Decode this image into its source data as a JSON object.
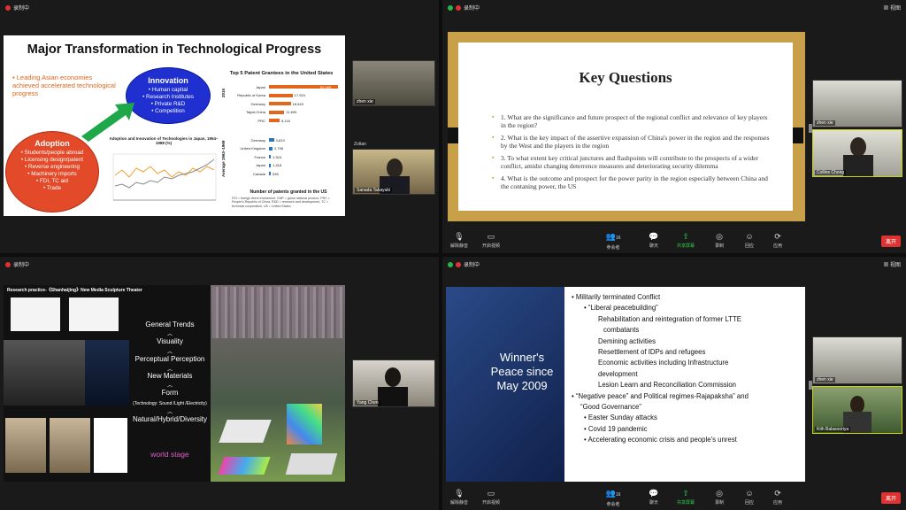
{
  "recording_label": "录制中",
  "view_label": "视图",
  "quad1": {
    "slide_title": "Major Transformation in Technological Progress",
    "lead_text": "Leading Asian economies achieved accelerated technological progress",
    "innovation": {
      "title": "Innovation",
      "items": [
        "Human capital",
        "Research Institutes",
        "Private R&D",
        "Competition"
      ]
    },
    "adoption": {
      "title": "Adoption",
      "items": [
        "Students/people abroad",
        "Licensing design/patent",
        "Reverse engineering",
        "Machinery imports",
        "FDI, TC aid",
        "Trade"
      ]
    },
    "chart_title": "Top 5 Patent Grantees in the United States",
    "chart_year_top": "2015",
    "chart_year_bottom": "Average 1963–1969",
    "chart_footer": "Number of patents granted in the US",
    "small_chart_title": "Adoption and Innovation of Technologies in Japan, 1954–1988 (%)",
    "footnote": "FDI = foreign direct investment, GNP = gross national product, PRC = People's Republic of China, R&D = research and development, TC = technical cooperation, US = United States",
    "participant1": "zhen xie",
    "participant2": "Zoltan",
    "participant2b": "Sanada Takayuki"
  },
  "chart_data": [
    {
      "type": "bar",
      "title": "Top 5 Patent Grantees in the United States",
      "xlabel": "Number of patents granted in the US",
      "groups": [
        {
          "name": "2015",
          "categories": [
            "Japan",
            "Republic of Korea",
            "Germany",
            "Taipei,China",
            "PRC"
          ],
          "values": [
            52409,
            17924,
            16549,
            11690,
            8116
          ]
        },
        {
          "name": "Average 1963–1969",
          "categories": [
            "Germany",
            "United Kingdom",
            "France",
            "Japan",
            "Canada"
          ],
          "values": [
            3819,
            2708,
            1324,
            1418,
            535
          ]
        }
      ]
    }
  ],
  "quad2": {
    "slide_title": "Key Questions",
    "questions": [
      "1. What are the significance and future prospect of the regional conflict and relevance of key players in the region?",
      "2. What is the key impact of the assertive expansion of China's power in the region and the responses by the West and the players in the region",
      "3. To what extent key critical junctures and flashpoints will contribute to the prospects of a wider conflict, amidst changing deterrence measures and deteriorating security dilemma",
      "4. What is the outcome and prospect for the power parity in the region especially between China and the contaning  power, the US"
    ],
    "participant1": "zhen xie",
    "participant2": "Collins Chong",
    "toolbar": [
      "解除静音",
      "开启视频",
      "参会者",
      "聊天",
      "共享屏幕",
      "录制",
      "回应",
      "应用"
    ],
    "participant_count": "16",
    "end_label": "离开"
  },
  "quad3": {
    "header": "Research practice-《Shanhaijing》New Media Sculpture Theater",
    "trends": [
      "General Trends",
      "Visuality",
      "Perceptual Perception",
      "New Materials",
      "Form",
      "(Technology: Sound /Light /Electricity)",
      "Natural/Hybrid/Diversity"
    ],
    "world_stage": "world stage",
    "participant": "Yang Chen"
  },
  "quad4": {
    "left_title": "Winner's Peace since May 2009",
    "lines": [
      {
        "level": 0,
        "text": "Militarily terminated Conflict"
      },
      {
        "level": 1,
        "text": "“Liberal peacebuilding”"
      },
      {
        "level": 2,
        "text": "Rehabilitation and reintegration of former LTTE"
      },
      {
        "level": 3,
        "text": "combatants"
      },
      {
        "level": 2,
        "text": "Demining activities"
      },
      {
        "level": 2,
        "text": "Resettlement of IDPs and refugees"
      },
      {
        "level": 2,
        "text": "Economic activities including Infrastructure"
      },
      {
        "level": 2,
        "text": "development"
      },
      {
        "level": 2,
        "text": "Lesion Learn and Reconciliation Commission"
      },
      {
        "level": 0,
        "text": "“Negative peace” and Political regimes-Rajapaksha” and"
      },
      {
        "level": 4,
        "text": "“Good Governance”"
      },
      {
        "level": 1,
        "text": "Easter Sunday attacks"
      },
      {
        "level": 1,
        "text": "Covid 19 pandemic"
      },
      {
        "level": 1,
        "text": "Accelerating economic crisis and people's unrest"
      }
    ],
    "participant1": "zhen xie",
    "participant2": "Kith Balasooriya",
    "toolbar": [
      "解除静音",
      "开启视频",
      "参会者",
      "聊天",
      "共享屏幕",
      "录制",
      "回应",
      "应用"
    ],
    "participant_count": "16",
    "end_label": "离开"
  }
}
